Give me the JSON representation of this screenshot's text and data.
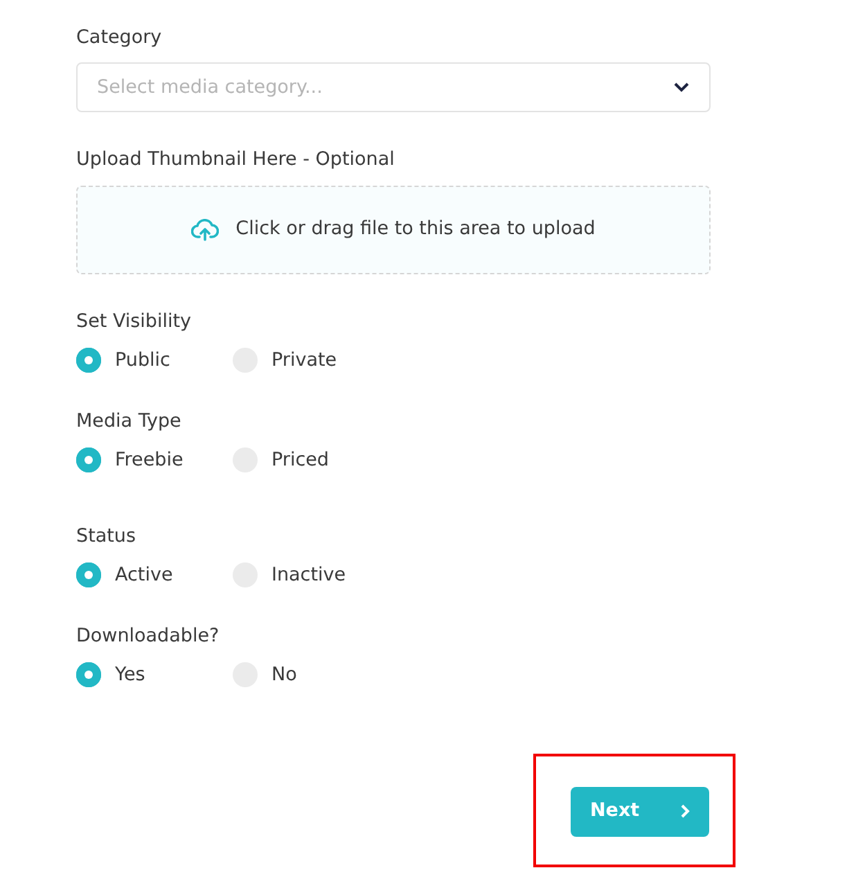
{
  "category": {
    "label": "Category",
    "placeholder": "Select media category..."
  },
  "thumbnail": {
    "label": "Upload Thumbnail Here - Optional",
    "prompt": "Click or drag file to this area to upload"
  },
  "radio_groups": [
    {
      "label": "Set Visibility",
      "options": [
        {
          "label": "Public",
          "selected": true
        },
        {
          "label": "Private",
          "selected": false
        }
      ]
    },
    {
      "label": "Media Type",
      "options": [
        {
          "label": "Freebie",
          "selected": true
        },
        {
          "label": "Priced",
          "selected": false
        }
      ]
    },
    {
      "label": "Status",
      "options": [
        {
          "label": "Active",
          "selected": true
        },
        {
          "label": "Inactive",
          "selected": false
        }
      ]
    },
    {
      "label": "Downloadable?",
      "options": [
        {
          "label": "Yes",
          "selected": true
        },
        {
          "label": "No",
          "selected": false
        }
      ]
    }
  ],
  "next_button": {
    "label": "Next",
    "highlighted": true
  }
}
